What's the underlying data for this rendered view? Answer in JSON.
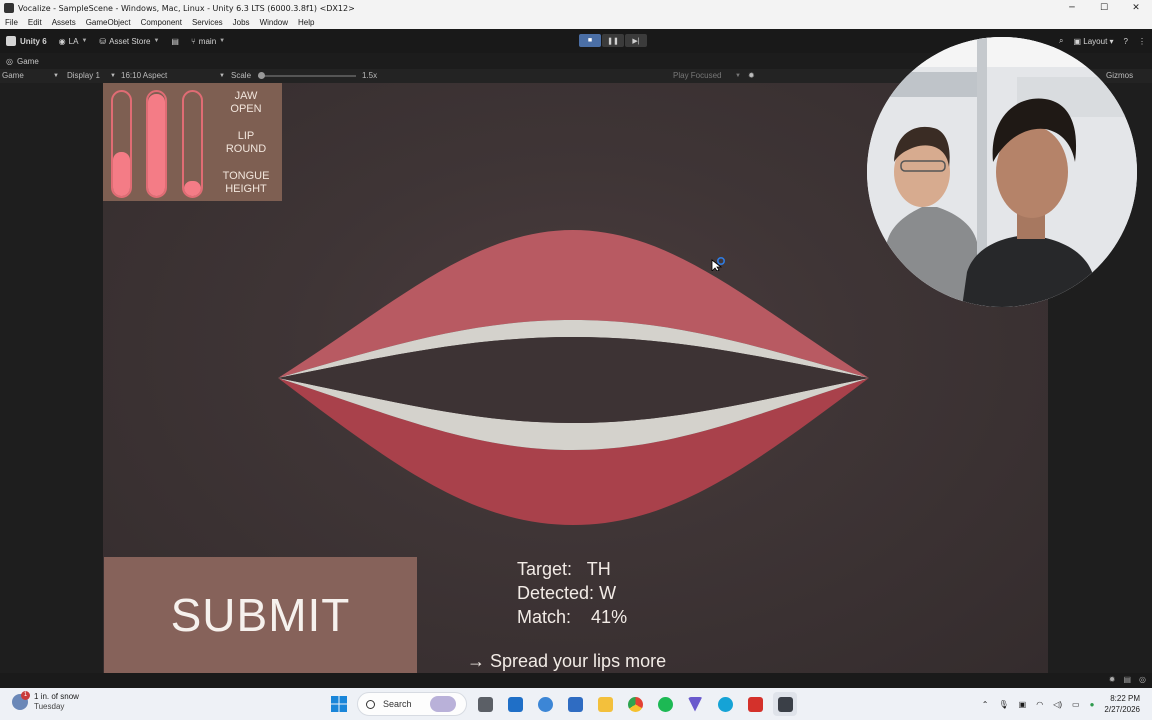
{
  "window": {
    "title": "Vocalize - SampleScene - Windows, Mac, Linux - Unity 6.3 LTS (6000.3.8f1) <DX12>",
    "controls": [
      "─",
      "☐",
      "✕"
    ]
  },
  "menu": [
    "File",
    "Edit",
    "Assets",
    "GameObject",
    "Component",
    "Services",
    "Jobs",
    "Window",
    "Help"
  ],
  "toolbar": {
    "unity_label": "Unity 6",
    "account": "LA",
    "asset_store": "Asset Store",
    "branch": "main",
    "layout": "Layout",
    "play_state": "playing"
  },
  "game_tab": {
    "label": "Game"
  },
  "game_bar": {
    "mode": "Game",
    "display": "Display 1",
    "aspect": "16:10 Aspect",
    "scale_label": "Scale",
    "scale_value": "1.5x",
    "play_mode": "Play Focused",
    "gizmos": "Gizmos"
  },
  "meters": [
    {
      "label_line1": "JAW",
      "label_line2": "OPEN",
      "level": 0.42
    },
    {
      "label_line1": "LIP",
      "label_line2": "ROUND",
      "level": 0.98
    },
    {
      "label_line1": "TONGUE",
      "label_line2": "HEIGHT",
      "level": 0.14
    }
  ],
  "feedback": {
    "target_label": "Target:",
    "target_value": "TH",
    "detected_label": "Detected:",
    "detected_value": "W",
    "match_label": "Match:",
    "match_value": "41%",
    "hint": "→ Spread your lips more"
  },
  "submit_label": "SUBMIT",
  "colors": {
    "panel": "#7e5f52",
    "submit": "#86625a",
    "meter_fill": "#f47c86",
    "upper_lip": "#b85a62",
    "lower_lip": "#a9414b",
    "teeth": "#d4d2cc",
    "background": "#3f3536"
  },
  "taskbar": {
    "weather_line1": "1 in. of snow",
    "weather_line2": "Tuesday",
    "weather_badge": "1",
    "search_placeholder": "Search",
    "time": "8:22 PM",
    "date": "2/27/2026"
  }
}
